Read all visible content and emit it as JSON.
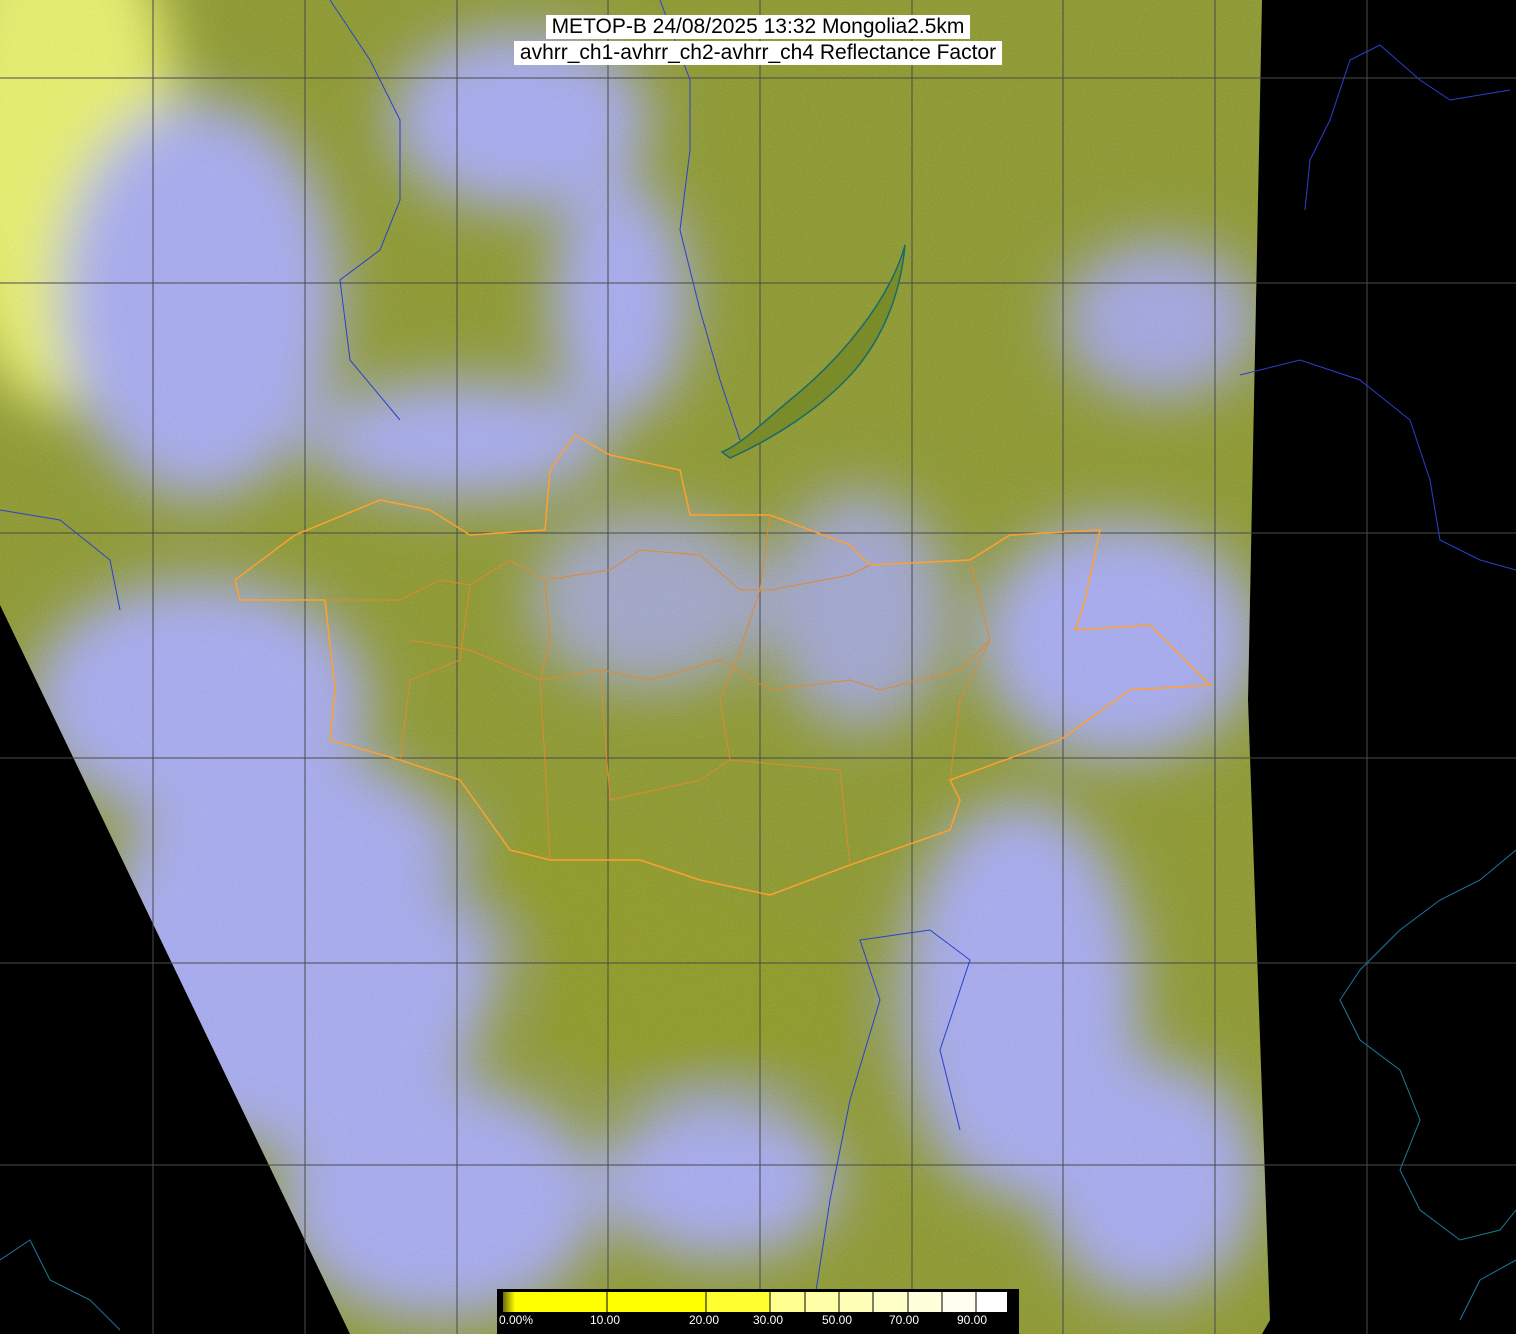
{
  "title": {
    "line1": "METOP-B 24/08/2025 13:32 Mongolia2.5km",
    "line2": "avhrr_ch1-avhrr_ch2-avhrr_ch4 Reflectance Factor"
  },
  "colorbar": {
    "labels": [
      "0.00%",
      "10.00",
      "20.00",
      "30.00",
      "50.00",
      "70.00",
      "90.00"
    ],
    "label_values": [
      0,
      10,
      20,
      30,
      50,
      70,
      90
    ],
    "range": [
      0,
      100
    ],
    "colors": {
      "low": "#ffff00",
      "high": "#ffffff"
    }
  },
  "colors": {
    "land_clear": "#8f9a2a",
    "cloud": "#a4a8f0",
    "border_country": "#ffa030",
    "coastline": "#1a6a8a",
    "rivers": "#2040d0",
    "grid": "#555555",
    "no_data": "#000000"
  }
}
